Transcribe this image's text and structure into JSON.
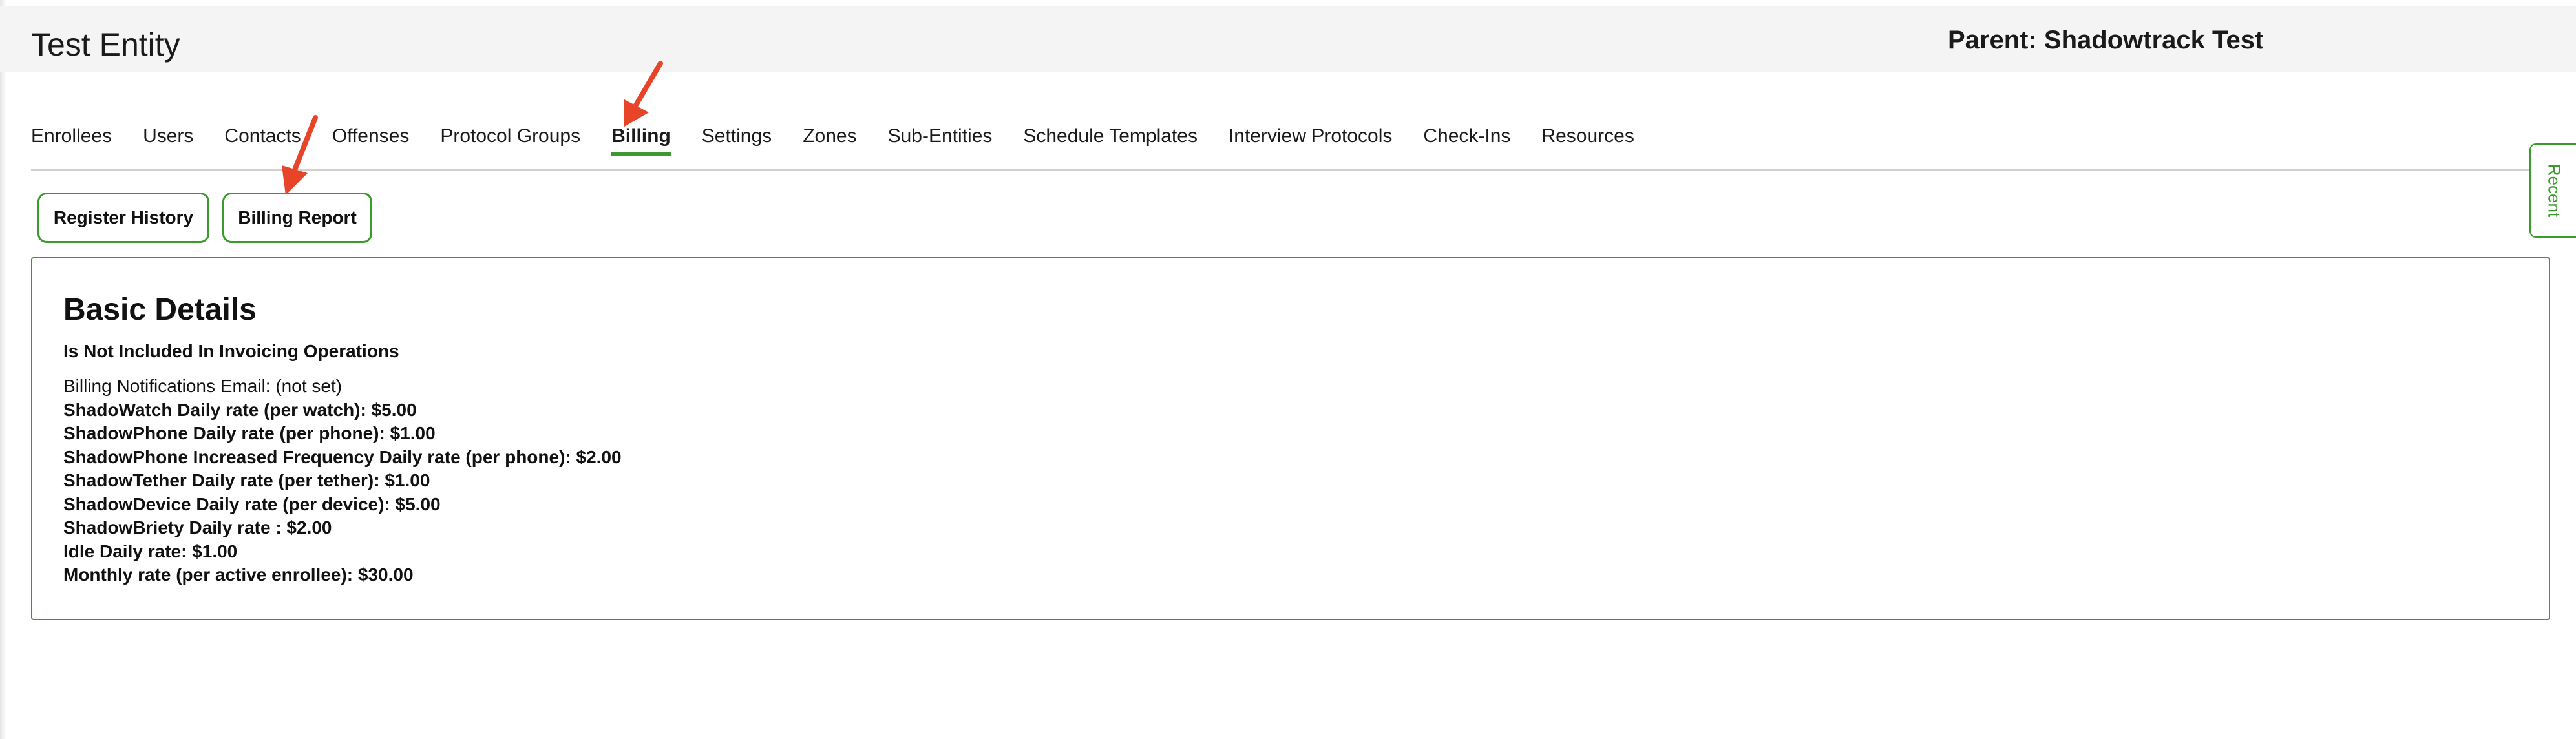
{
  "header": {
    "entity_title": "Test Entity",
    "parent_title": "Parent: Shadowtrack Test"
  },
  "tabs": [
    {
      "label": "Enrollees",
      "active": false
    },
    {
      "label": "Users",
      "active": false
    },
    {
      "label": "Contacts",
      "active": false
    },
    {
      "label": "Offenses",
      "active": false
    },
    {
      "label": "Protocol Groups",
      "active": false
    },
    {
      "label": "Billing",
      "active": true
    },
    {
      "label": "Settings",
      "active": false
    },
    {
      "label": "Zones",
      "active": false
    },
    {
      "label": "Sub-Entities",
      "active": false
    },
    {
      "label": "Schedule Templates",
      "active": false
    },
    {
      "label": "Interview Protocols",
      "active": false
    },
    {
      "label": "Check-Ins",
      "active": false
    },
    {
      "label": "Resources",
      "active": false
    }
  ],
  "sub_actions": {
    "register_history_label": "Register History",
    "billing_report_label": "Billing Report"
  },
  "details": {
    "title": "Basic Details",
    "invoicing_status": "Is Not Included In Invoicing Operations",
    "notifications_email": "Billing Notifications Email: (not set)",
    "rates": [
      "ShadoWatch Daily rate (per watch): $5.00",
      "ShadowPhone Daily rate (per phone): $1.00",
      "ShadowPhone Increased Frequency Daily rate (per phone): $2.00",
      "ShadowTether Daily rate (per tether): $1.00",
      "ShadowDevice Daily rate (per device): $5.00",
      "ShadowBriety Daily rate : $2.00",
      "Idle Daily rate: $1.00",
      "Monthly rate (per active enrollee): $30.00"
    ]
  },
  "recent_tab": {
    "label": "Recent"
  },
  "colors": {
    "accent_green": "#3a9a2c",
    "annotation_arrow": "#e8442a",
    "header_background": "#f4f4f4"
  }
}
